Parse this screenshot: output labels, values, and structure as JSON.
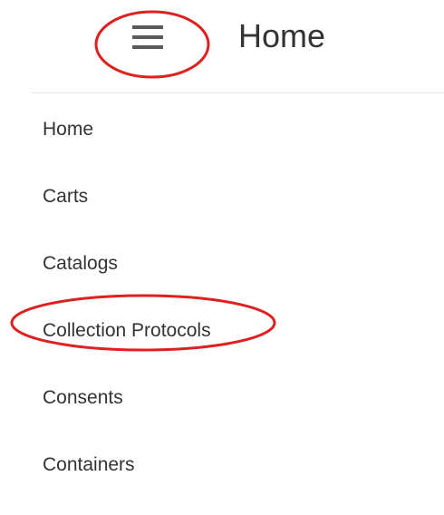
{
  "header": {
    "title": "Home",
    "menu_icon": "hamburger-menu-icon"
  },
  "sidebar": {
    "items": [
      {
        "label": "Home"
      },
      {
        "label": "Carts"
      },
      {
        "label": "Catalogs"
      },
      {
        "label": "Collection Protocols"
      },
      {
        "label": "Consents"
      },
      {
        "label": "Containers"
      }
    ]
  },
  "annotations": {
    "highlight_color": "#e02020"
  }
}
